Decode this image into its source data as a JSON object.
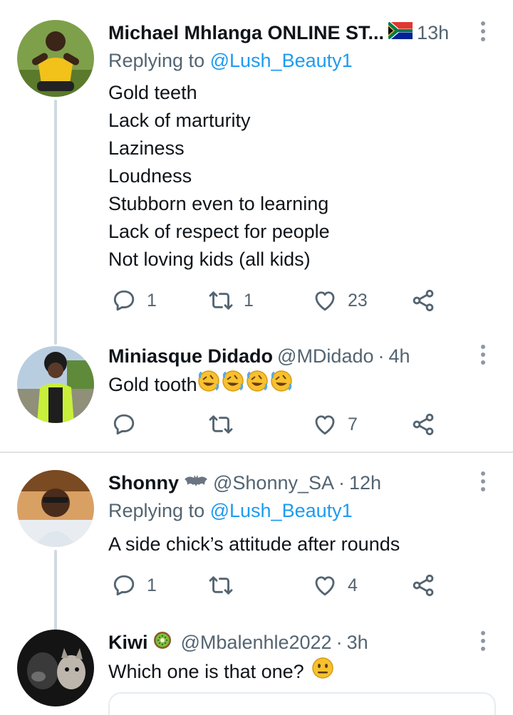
{
  "tweets": [
    {
      "name": "Michael Mhlanga ONLINE ST...",
      "time": "13h",
      "replying_prefix": "Replying to ",
      "replying_handle": "@Lush_Beauty1",
      "lines": [
        "Gold teeth",
        "Lack of marturity",
        "Laziness",
        "Loudness",
        "Stubborn even to learning",
        "Lack of respect for people",
        "Not loving kids (all kids)"
      ],
      "reply_count": "1",
      "retweet_count": "1",
      "like_count": "23"
    },
    {
      "name": "Miniasque Didado",
      "handle": "@MDidado",
      "separator": "·",
      "time": "4h",
      "text": "Gold tooth",
      "like_count": "7"
    },
    {
      "name": "Shonny",
      "handle": "@Shonny_SA",
      "separator": "·",
      "time": "12h",
      "replying_prefix": "Replying to ",
      "replying_handle": "@Lush_Beauty1",
      "text": "A side chick’s attitude after rounds",
      "reply_count": "1",
      "like_count": "4"
    },
    {
      "name": "Kiwi",
      "handle": "@Mbalenhle2022",
      "separator": "·",
      "time": "3h",
      "text": "Which one is that one?"
    }
  ],
  "icons": {
    "reply": "reply-icon",
    "retweet": "retweet-icon",
    "like": "heart-icon",
    "share": "share-icon",
    "more": "more-options-icon",
    "flag": "south-africa-flag-icon",
    "bat": "bat-emoji-icon",
    "kiwi": "kiwi-emoji-icon",
    "laugh": "rolling-on-floor-laughing-emoji-icon",
    "neutral": "neutral-face-emoji-icon"
  },
  "colors": {
    "link": "#1d9bf0",
    "secondary_text": "#536471",
    "thread_line": "#cfd9de",
    "separator": "#dfe3e6"
  }
}
